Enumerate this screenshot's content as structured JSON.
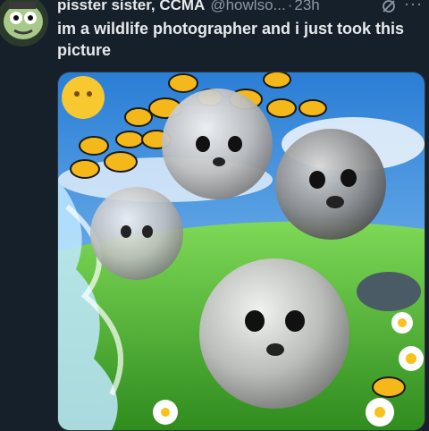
{
  "post": {
    "author_name": "pisster sister, CCMA",
    "handle": "@howlso...",
    "separator": "·",
    "timestamp": "23h",
    "more_label": "···",
    "text": "im a wildlife photographer and i just took this picture"
  },
  "icons": {
    "avatar": "avatar-icon",
    "grok": "grok-icon",
    "more": "more-icon"
  },
  "colors": {
    "background": "#15202b",
    "text": "#e7e9ea",
    "muted": "#8b98a5"
  }
}
